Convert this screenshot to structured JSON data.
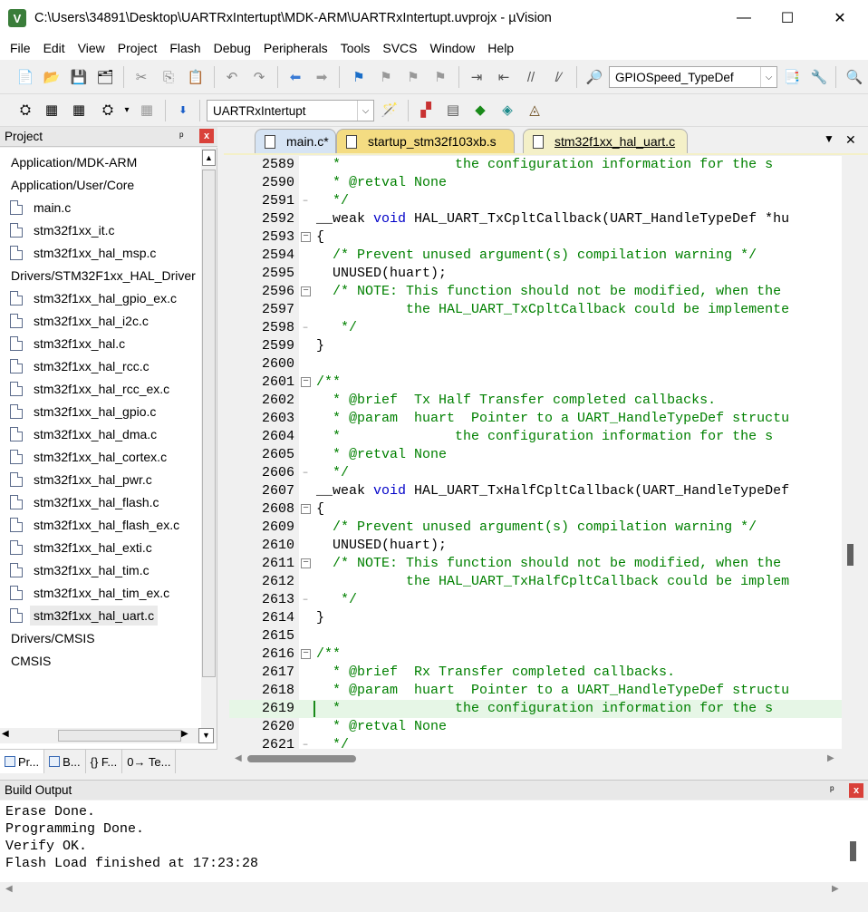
{
  "window": {
    "title": "C:\\Users\\34891\\Desktop\\UARTRxIntertupt\\MDK-ARM\\UARTRxIntertupt.uvprojx - µVision",
    "minimize": "—",
    "maximize": "☐",
    "close": "✕"
  },
  "menu": [
    "File",
    "Edit",
    "View",
    "Project",
    "Flash",
    "Debug",
    "Peripherals",
    "Tools",
    "SVCS",
    "Window",
    "Help"
  ],
  "toolbar": {
    "find_combo_value": "GPIOSpeed_TypeDef",
    "target_combo_value": "UARTRxIntertupt"
  },
  "project_panel": {
    "title": "Project",
    "pin": "ᵖ",
    "close": "x",
    "tree": [
      {
        "kind": "folder",
        "label": "Application/MDK-ARM"
      },
      {
        "kind": "folder",
        "label": "Application/User/Core"
      },
      {
        "kind": "file",
        "label": "main.c"
      },
      {
        "kind": "file",
        "label": "stm32f1xx_it.c"
      },
      {
        "kind": "file",
        "label": "stm32f1xx_hal_msp.c"
      },
      {
        "kind": "folder",
        "label": "Drivers/STM32F1xx_HAL_Driver"
      },
      {
        "kind": "file",
        "label": "stm32f1xx_hal_gpio_ex.c"
      },
      {
        "kind": "file",
        "label": "stm32f1xx_hal_i2c.c"
      },
      {
        "kind": "file",
        "label": "stm32f1xx_hal.c"
      },
      {
        "kind": "file",
        "label": "stm32f1xx_hal_rcc.c"
      },
      {
        "kind": "file",
        "label": "stm32f1xx_hal_rcc_ex.c"
      },
      {
        "kind": "file",
        "label": "stm32f1xx_hal_gpio.c"
      },
      {
        "kind": "file",
        "label": "stm32f1xx_hal_dma.c"
      },
      {
        "kind": "file",
        "label": "stm32f1xx_hal_cortex.c"
      },
      {
        "kind": "file",
        "label": "stm32f1xx_hal_pwr.c"
      },
      {
        "kind": "file",
        "label": "stm32f1xx_hal_flash.c"
      },
      {
        "kind": "file",
        "label": "stm32f1xx_hal_flash_ex.c"
      },
      {
        "kind": "file",
        "label": "stm32f1xx_hal_exti.c"
      },
      {
        "kind": "file",
        "label": "stm32f1xx_hal_tim.c"
      },
      {
        "kind": "file",
        "label": "stm32f1xx_hal_tim_ex.c"
      },
      {
        "kind": "file",
        "label": "stm32f1xx_hal_uart.c",
        "selected": true
      },
      {
        "kind": "folder",
        "label": "Drivers/CMSIS"
      },
      {
        "kind": "folder",
        "label": "CMSIS"
      }
    ],
    "bottom_tabs": [
      "Pr...",
      "B...",
      "{} F...",
      "0→ Te..."
    ]
  },
  "editor": {
    "tabs": [
      {
        "label": "main.c*"
      },
      {
        "label": "startup_stm32f103xb.s"
      },
      {
        "label": "stm32f1xx_hal_uart.c",
        "active": true
      }
    ],
    "tab_dropdown": "▼",
    "tab_close": "✕",
    "lines": [
      {
        "n": "2589",
        "f": "",
        "t": "  *              the configuration information for the s",
        "c": "cm"
      },
      {
        "n": "2590",
        "f": "",
        "t": "  * @retval None",
        "c": "cm"
      },
      {
        "n": "2591",
        "f": "-",
        "t": "  */",
        "c": "cm"
      },
      {
        "n": "2592",
        "f": "",
        "t": "__weak void HAL_UART_TxCpltCallback(UART_HandleTypeDef *hu",
        "c": "fn1"
      },
      {
        "n": "2593",
        "f": "box",
        "t": "{",
        "c": "pl"
      },
      {
        "n": "2594",
        "f": "",
        "t": "  /* Prevent unused argument(s) compilation warning */",
        "c": "cm"
      },
      {
        "n": "2595",
        "f": "",
        "t": "  UNUSED(huart);",
        "c": "pl"
      },
      {
        "n": "2596",
        "f": "box",
        "t": "  /* NOTE: This function should not be modified, when the",
        "c": "cm"
      },
      {
        "n": "2597",
        "f": "",
        "t": "           the HAL_UART_TxCpltCallback could be implemente",
        "c": "cm"
      },
      {
        "n": "2598",
        "f": "-",
        "t": "   */",
        "c": "cm"
      },
      {
        "n": "2599",
        "f": "",
        "t": "}",
        "c": "pl"
      },
      {
        "n": "2600",
        "f": "",
        "t": "",
        "c": "pl"
      },
      {
        "n": "2601",
        "f": "box",
        "t": "/**",
        "c": "cm"
      },
      {
        "n": "2602",
        "f": "",
        "t": "  * @brief  Tx Half Transfer completed callbacks.",
        "c": "cm"
      },
      {
        "n": "2603",
        "f": "",
        "t": "  * @param  huart  Pointer to a UART_HandleTypeDef structu",
        "c": "cm"
      },
      {
        "n": "2604",
        "f": "",
        "t": "  *              the configuration information for the s",
        "c": "cm"
      },
      {
        "n": "2605",
        "f": "",
        "t": "  * @retval None",
        "c": "cm"
      },
      {
        "n": "2606",
        "f": "-",
        "t": "  */",
        "c": "cm"
      },
      {
        "n": "2607",
        "f": "",
        "t": "__weak void HAL_UART_TxHalfCpltCallback(UART_HandleTypeDef",
        "c": "fn2"
      },
      {
        "n": "2608",
        "f": "box",
        "t": "{",
        "c": "pl"
      },
      {
        "n": "2609",
        "f": "",
        "t": "  /* Prevent unused argument(s) compilation warning */",
        "c": "cm"
      },
      {
        "n": "2610",
        "f": "",
        "t": "  UNUSED(huart);",
        "c": "pl"
      },
      {
        "n": "2611",
        "f": "box",
        "t": "  /* NOTE: This function should not be modified, when the",
        "c": "cm"
      },
      {
        "n": "2612",
        "f": "",
        "t": "           the HAL_UART_TxHalfCpltCallback could be implem",
        "c": "cm"
      },
      {
        "n": "2613",
        "f": "-",
        "t": "   */",
        "c": "cm"
      },
      {
        "n": "2614",
        "f": "",
        "t": "}",
        "c": "pl"
      },
      {
        "n": "2615",
        "f": "",
        "t": "",
        "c": "pl"
      },
      {
        "n": "2616",
        "f": "box",
        "t": "/**",
        "c": "cm"
      },
      {
        "n": "2617",
        "f": "",
        "t": "  * @brief  Rx Transfer completed callbacks.",
        "c": "cm"
      },
      {
        "n": "2618",
        "f": "",
        "t": "  * @param  huart  Pointer to a UART_HandleTypeDef structu",
        "c": "cm"
      },
      {
        "n": "2619",
        "f": "",
        "t": "  *              the configuration information for the s",
        "c": "cm",
        "hl": true
      },
      {
        "n": "2620",
        "f": "",
        "t": "  * @retval None",
        "c": "cm"
      },
      {
        "n": "2621",
        "f": "-",
        "t": "  */",
        "c": "cm"
      }
    ]
  },
  "build_output": {
    "title": "Build Output",
    "pin": "ᵖ",
    "close": "x",
    "lines": [
      "Erase Done.",
      "Programming Done.",
      "Verify OK.",
      "Flash Load finished at 17:23:28"
    ]
  },
  "colors": {
    "comment": "#008000",
    "keyword": "#0000c8",
    "active_tab": "#f4f0c8",
    "startup_tab": "#f4dc82",
    "main_tab": "#d6e4f4",
    "current_line": "#e6f6e6"
  }
}
